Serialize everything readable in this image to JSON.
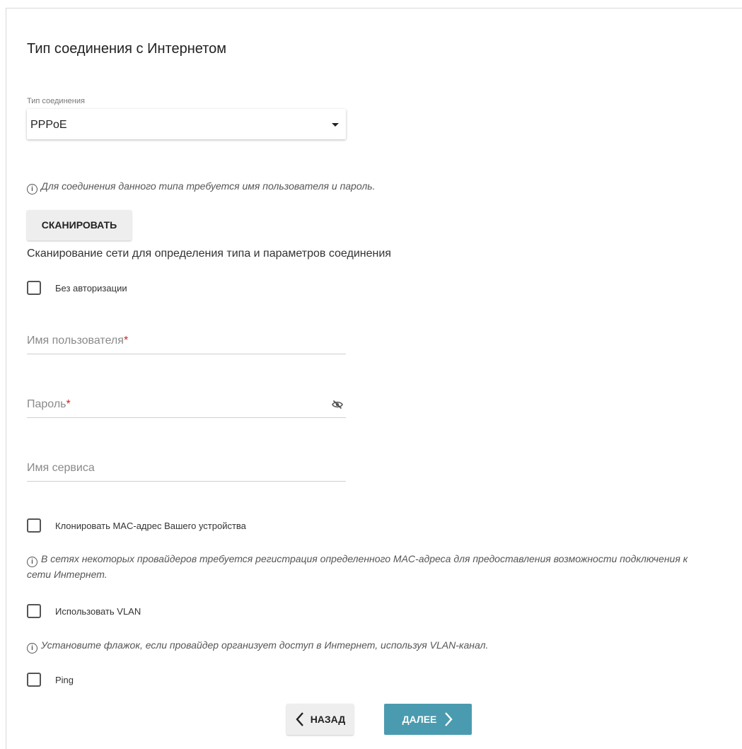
{
  "page": {
    "title": "Тип соединения с Интернетом"
  },
  "connection_type": {
    "label": "Тип соединения",
    "value": "PPPoE"
  },
  "info_credentials": "Для соединения данного типа требуется имя пользователя и пароль.",
  "scan": {
    "button_label": "СКАНИРОВАТЬ",
    "description": "Сканирование сети для определения типа и параметров соединения"
  },
  "no_auth": {
    "label": "Без авторизации",
    "checked": false
  },
  "fields": {
    "username": {
      "label": "Имя пользователя",
      "required_mark": "*"
    },
    "password": {
      "label": "Пароль",
      "required_mark": "*"
    },
    "service_name": {
      "label": "Имя сервиса"
    }
  },
  "clone_mac": {
    "label": "Клонировать MAC-адрес Вашего устройства",
    "checked": false,
    "info": "В сетях некоторых провайдеров требуется регистрация определенного MAC-адреса для предоставления возможности подключения к сети Интернет."
  },
  "vlan": {
    "label": "Использовать VLAN",
    "checked": false,
    "info": "Установите флажок, если провайдер организует доступ в Интернет, используя VLAN-канал."
  },
  "ping": {
    "label": "Ping",
    "checked": false
  },
  "nav": {
    "back_label": "НАЗАД",
    "next_label": "ДАЛЕЕ"
  },
  "icons": {
    "info": "info-circle-icon",
    "caret": "caret-down-icon",
    "password_visibility": "eye-off-icon",
    "back": "chevron-left-icon",
    "next": "chevron-right-icon"
  },
  "colors": {
    "primary_button": "#4a9bb0",
    "secondary_button": "#eeeeee",
    "required": "#c62828"
  }
}
